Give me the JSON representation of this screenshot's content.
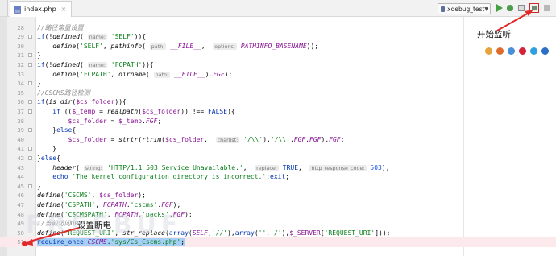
{
  "tab": {
    "title": "index.php",
    "close": "×"
  },
  "toolbar": {
    "run_config": "xdebug_test"
  },
  "annotations": {
    "start_listen": "开始监听",
    "set_breakpoint": "设置断电",
    "color": "#e0292b"
  },
  "watermark": "FREEBUF",
  "browsers": [
    {
      "name": "chrome-icon",
      "color": "#e8a33a"
    },
    {
      "name": "firefox-icon",
      "color": "#e06a2a"
    },
    {
      "name": "safari-icon",
      "color": "#4a90d9"
    },
    {
      "name": "opera-icon",
      "color": "#d2233a"
    },
    {
      "name": "ie-icon",
      "color": "#2e9fe0"
    },
    {
      "name": "edge-icon",
      "color": "#2c6fc4"
    }
  ],
  "lines": [
    {
      "n": "28",
      "seg": [
        {
          "c": "cm",
          "t": "//路径常量设置"
        }
      ]
    },
    {
      "n": "29",
      "fold": true,
      "seg": [
        {
          "c": "kw",
          "t": "if"
        },
        {
          "c": "",
          "t": "(!"
        },
        {
          "c": "fn",
          "t": "defined"
        },
        {
          "c": "",
          "t": "( "
        },
        {
          "c": "hint",
          "t": "name:"
        },
        {
          "c": "",
          "t": " "
        },
        {
          "c": "str",
          "t": "'SELF'"
        },
        {
          "c": "",
          "t": ")){"
        }
      ]
    },
    {
      "n": "30",
      "seg": [
        {
          "c": "",
          "t": "    "
        },
        {
          "c": "fn",
          "t": "define"
        },
        {
          "c": "",
          "t": "("
        },
        {
          "c": "str",
          "t": "'SELF'"
        },
        {
          "c": "",
          "t": ", "
        },
        {
          "c": "fn",
          "t": "pathinfo"
        },
        {
          "c": "",
          "t": "( "
        },
        {
          "c": "hint",
          "t": "path:"
        },
        {
          "c": "",
          "t": " "
        },
        {
          "c": "const",
          "t": "__FILE__"
        },
        {
          "c": "",
          "t": ",  "
        },
        {
          "c": "hint",
          "t": "options:"
        },
        {
          "c": "",
          "t": " "
        },
        {
          "c": "const",
          "t": "PATHINFO_BASENAME"
        },
        {
          "c": "",
          "t": "));"
        }
      ]
    },
    {
      "n": "31",
      "fold": true,
      "seg": [
        {
          "c": "",
          "t": "}"
        }
      ]
    },
    {
      "n": "32",
      "fold": true,
      "seg": [
        {
          "c": "kw",
          "t": "if"
        },
        {
          "c": "",
          "t": "(!"
        },
        {
          "c": "fn",
          "t": "defined"
        },
        {
          "c": "",
          "t": "( "
        },
        {
          "c": "hint",
          "t": "name:"
        },
        {
          "c": "",
          "t": " "
        },
        {
          "c": "str",
          "t": "'FCPATH'"
        },
        {
          "c": "",
          "t": ")){"
        }
      ]
    },
    {
      "n": "33",
      "seg": [
        {
          "c": "",
          "t": "    "
        },
        {
          "c": "fn",
          "t": "define"
        },
        {
          "c": "",
          "t": "("
        },
        {
          "c": "str",
          "t": "'FCPATH'"
        },
        {
          "c": "",
          "t": ", "
        },
        {
          "c": "fn",
          "t": "dirname"
        },
        {
          "c": "",
          "t": "( "
        },
        {
          "c": "hint",
          "t": "path:"
        },
        {
          "c": "",
          "t": " "
        },
        {
          "c": "const",
          "t": "__FILE__"
        },
        {
          "c": "",
          "t": ")."
        },
        {
          "c": "const",
          "t": "FGF"
        },
        {
          "c": "",
          "t": ");"
        }
      ]
    },
    {
      "n": "34",
      "fold": true,
      "seg": [
        {
          "c": "",
          "t": "}"
        }
      ]
    },
    {
      "n": "35",
      "seg": [
        {
          "c": "cm",
          "t": "//CSCMS路径检测"
        }
      ]
    },
    {
      "n": "36",
      "fold": true,
      "seg": [
        {
          "c": "kw",
          "t": "if"
        },
        {
          "c": "",
          "t": "("
        },
        {
          "c": "fn",
          "t": "is_dir"
        },
        {
          "c": "",
          "t": "("
        },
        {
          "c": "var",
          "t": "$cs_folder"
        },
        {
          "c": "",
          "t": ")){"
        }
      ]
    },
    {
      "n": "37",
      "fold": true,
      "seg": [
        {
          "c": "",
          "t": "    "
        },
        {
          "c": "kw",
          "t": "if"
        },
        {
          "c": "",
          "t": " (("
        },
        {
          "c": "var",
          "t": "$_temp"
        },
        {
          "c": "",
          "t": " = "
        },
        {
          "c": "fn",
          "t": "realpath"
        },
        {
          "c": "",
          "t": "("
        },
        {
          "c": "var",
          "t": "$cs_folder"
        },
        {
          "c": "",
          "t": ")) !== "
        },
        {
          "c": "kw",
          "t": "FALSE"
        },
        {
          "c": "",
          "t": "){"
        }
      ]
    },
    {
      "n": "38",
      "seg": [
        {
          "c": "",
          "t": "        "
        },
        {
          "c": "var",
          "t": "$cs_folder"
        },
        {
          "c": "",
          "t": " = "
        },
        {
          "c": "var",
          "t": "$_temp"
        },
        {
          "c": "",
          "t": "."
        },
        {
          "c": "const",
          "t": "FGF"
        },
        {
          "c": "",
          "t": ";"
        }
      ]
    },
    {
      "n": "39",
      "fold": true,
      "seg": [
        {
          "c": "",
          "t": "    }"
        },
        {
          "c": "kw",
          "t": "else"
        },
        {
          "c": "",
          "t": "{"
        }
      ]
    },
    {
      "n": "40",
      "seg": [
        {
          "c": "",
          "t": "        "
        },
        {
          "c": "var",
          "t": "$cs_folder"
        },
        {
          "c": "",
          "t": " = "
        },
        {
          "c": "fn",
          "t": "strtr"
        },
        {
          "c": "",
          "t": "("
        },
        {
          "c": "fn",
          "t": "rtrim"
        },
        {
          "c": "",
          "t": "("
        },
        {
          "c": "var",
          "t": "$cs_folder"
        },
        {
          "c": "",
          "t": ",  "
        },
        {
          "c": "hint",
          "t": "charlist:"
        },
        {
          "c": "",
          "t": " "
        },
        {
          "c": "str",
          "t": "'/\\\\'"
        },
        {
          "c": "",
          "t": "),"
        },
        {
          "c": "str",
          "t": "'/\\\\'"
        },
        {
          "c": "",
          "t": ","
        },
        {
          "c": "const",
          "t": "FGF"
        },
        {
          "c": "",
          "t": "."
        },
        {
          "c": "const",
          "t": "FGF"
        },
        {
          "c": "",
          "t": ")."
        },
        {
          "c": "const",
          "t": "FGF"
        },
        {
          "c": "",
          "t": ";"
        }
      ]
    },
    {
      "n": "41",
      "fold": true,
      "seg": [
        {
          "c": "",
          "t": "    }"
        }
      ]
    },
    {
      "n": "42",
      "fold": true,
      "seg": [
        {
          "c": "",
          "t": "}"
        },
        {
          "c": "kw",
          "t": "else"
        },
        {
          "c": "",
          "t": "{"
        }
      ]
    },
    {
      "n": "43",
      "seg": [
        {
          "c": "",
          "t": "    "
        },
        {
          "c": "fn",
          "t": "header"
        },
        {
          "c": "",
          "t": "( "
        },
        {
          "c": "hint",
          "t": "string:"
        },
        {
          "c": "",
          "t": " "
        },
        {
          "c": "str",
          "t": "'HTTP/1.1 503 Service Unavailable.'"
        },
        {
          "c": "",
          "t": ",  "
        },
        {
          "c": "hint",
          "t": "replace:"
        },
        {
          "c": "",
          "t": " "
        },
        {
          "c": "kw",
          "t": "TRUE"
        },
        {
          "c": "",
          "t": ",  "
        },
        {
          "c": "hint",
          "t": "http_response_code:"
        },
        {
          "c": "",
          "t": " "
        },
        {
          "c": "num",
          "t": "503"
        },
        {
          "c": "",
          "t": ");"
        }
      ]
    },
    {
      "n": "44",
      "seg": [
        {
          "c": "",
          "t": "    "
        },
        {
          "c": "kw",
          "t": "echo"
        },
        {
          "c": "",
          "t": " "
        },
        {
          "c": "str",
          "t": "'The kernel configuration directory is incorrect.'"
        },
        {
          "c": "",
          "t": ";"
        },
        {
          "c": "kw",
          "t": "exit"
        },
        {
          "c": "",
          "t": ";"
        }
      ]
    },
    {
      "n": "45",
      "fold": true,
      "seg": [
        {
          "c": "",
          "t": "}"
        }
      ]
    },
    {
      "n": "46",
      "seg": [
        {
          "c": "fn",
          "t": "define"
        },
        {
          "c": "",
          "t": "("
        },
        {
          "c": "str",
          "t": "'CSCMS'"
        },
        {
          "c": "",
          "t": ", "
        },
        {
          "c": "var",
          "t": "$cs_folder"
        },
        {
          "c": "",
          "t": ");"
        }
      ]
    },
    {
      "n": "47",
      "seg": [
        {
          "c": "fn",
          "t": "define"
        },
        {
          "c": "",
          "t": "("
        },
        {
          "c": "str",
          "t": "'CSPATH'"
        },
        {
          "c": "",
          "t": ", "
        },
        {
          "c": "const",
          "t": "FCPATH"
        },
        {
          "c": "",
          "t": "."
        },
        {
          "c": "str",
          "t": "'cscms'"
        },
        {
          "c": "",
          "t": "."
        },
        {
          "c": "const",
          "t": "FGF"
        },
        {
          "c": "",
          "t": ");"
        }
      ]
    },
    {
      "n": "48",
      "seg": [
        {
          "c": "fn",
          "t": "define"
        },
        {
          "c": "",
          "t": "("
        },
        {
          "c": "str",
          "t": "'CSCMSPATH'"
        },
        {
          "c": "",
          "t": ", "
        },
        {
          "c": "const",
          "t": "FCPATH"
        },
        {
          "c": "",
          "t": "."
        },
        {
          "c": "str",
          "t": "'packs'"
        },
        {
          "c": "",
          "t": "."
        },
        {
          "c": "const",
          "t": "FGF"
        },
        {
          "c": "",
          "t": ");"
        }
      ]
    },
    {
      "n": "49",
      "seg": [
        {
          "c": "cm",
          "t": "//当前访问URI"
        }
      ]
    },
    {
      "n": "50",
      "seg": [
        {
          "c": "fn",
          "t": "define"
        },
        {
          "c": "",
          "t": "("
        },
        {
          "c": "str",
          "t": "'REQUEST_URI'"
        },
        {
          "c": "",
          "t": ", "
        },
        {
          "c": "fn",
          "t": "str_replace"
        },
        {
          "c": "",
          "t": "("
        },
        {
          "c": "kw",
          "t": "array"
        },
        {
          "c": "",
          "t": "("
        },
        {
          "c": "const",
          "t": "SELF"
        },
        {
          "c": "",
          "t": ","
        },
        {
          "c": "str",
          "t": "'//'"
        },
        {
          "c": "",
          "t": "),"
        },
        {
          "c": "kw",
          "t": "array"
        },
        {
          "c": "",
          "t": "("
        },
        {
          "c": "str",
          "t": "''"
        },
        {
          "c": "",
          "t": ","
        },
        {
          "c": "str",
          "t": "'/'"
        },
        {
          "c": "",
          "t": "),"
        },
        {
          "c": "var",
          "t": "$_SERVER"
        },
        {
          "c": "",
          "t": "["
        },
        {
          "c": "str",
          "t": "'REQUEST_URI'"
        },
        {
          "c": "",
          "t": "]));"
        }
      ]
    },
    {
      "n": "51",
      "hl": true,
      "seg": [
        {
          "c": "sel-kw",
          "t": "require_once"
        },
        {
          "c": "sel",
          "t": " "
        },
        {
          "c": "sel-const",
          "t": "CSCMS"
        },
        {
          "c": "sel",
          "t": "."
        },
        {
          "c": "sel-str",
          "t": "'sys/Cs_Cscms.php'"
        },
        {
          "c": "sel",
          "t": ";"
        }
      ]
    }
  ]
}
